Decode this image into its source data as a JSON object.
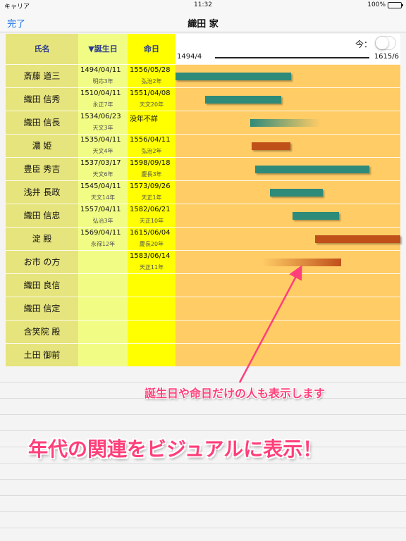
{
  "status": {
    "carrier": "キャリア",
    "time": "11:32",
    "battery": "100%"
  },
  "nav": {
    "done": "完了",
    "title": "織田 家"
  },
  "columns": {
    "name": "氏名",
    "birth": "▼誕生日",
    "death": "命日"
  },
  "timeline": {
    "now_label": "今：",
    "now_toggle_on": false,
    "start": "1494/4",
    "end": "1615/6",
    "start_year": 1494.25,
    "end_year": 1615.45
  },
  "colors": {
    "male": "#2e8b7a",
    "female": "#c0501a",
    "accent": "#ff3f7a"
  },
  "rows": [
    {
      "name": "斎藤 道三",
      "birth": "1494/04/11",
      "birth_era": "明応3年",
      "death": "1556/05/28",
      "death_era": "弘治2年",
      "bar_start": 1494.3,
      "bar_end": 1556.4,
      "color": "male",
      "fade": ""
    },
    {
      "name": "織田 信秀",
      "birth": "1510/04/11",
      "birth_era": "永正7年",
      "death": "1551/04/08",
      "death_era": "天文20年",
      "bar_start": 1510.3,
      "bar_end": 1551.3,
      "color": "male",
      "fade": ""
    },
    {
      "name": "織田 信長",
      "birth": "1534/06/23",
      "birth_era": "天文3年",
      "death": "没年不詳",
      "death_era": "",
      "bar_start": 1534.5,
      "bar_end": 1572.0,
      "color": "male",
      "fade": "fade-start"
    },
    {
      "name": "濃 姫",
      "birth": "1535/04/11",
      "birth_era": "天文4年",
      "death": "1556/04/11",
      "death_era": "弘治2年",
      "bar_start": 1535.3,
      "bar_end": 1556.3,
      "color": "female",
      "fade": ""
    },
    {
      "name": "豊臣 秀吉",
      "birth": "1537/03/17",
      "birth_era": "天文6年",
      "death": "1598/09/18",
      "death_era": "慶長3年",
      "bar_start": 1537.2,
      "bar_end": 1598.7,
      "color": "male",
      "fade": ""
    },
    {
      "name": "浅井 長政",
      "birth": "1545/04/11",
      "birth_era": "天文14年",
      "death": "1573/09/26",
      "death_era": "天正1年",
      "bar_start": 1545.3,
      "bar_end": 1573.7,
      "color": "male",
      "fade": ""
    },
    {
      "name": "織田 信忠",
      "birth": "1557/04/11",
      "birth_era": "弘治3年",
      "death": "1582/06/21",
      "death_era": "天正10年",
      "bar_start": 1557.3,
      "bar_end": 1582.5,
      "color": "male",
      "fade": ""
    },
    {
      "name": "淀 殿",
      "birth": "1569/04/11",
      "birth_era": "永禄12年",
      "death": "1615/06/04",
      "death_era": "慶長20年",
      "bar_start": 1569.3,
      "bar_end": 1615.45,
      "color": "female",
      "fade": ""
    },
    {
      "name": "お市 の方",
      "birth": "",
      "birth_era": "",
      "death": "1583/06/14",
      "death_era": "天正11年",
      "bar_start": 1541.0,
      "bar_end": 1583.4,
      "color": "female",
      "fade": "fade-end"
    },
    {
      "name": "織田 良信",
      "birth": "",
      "birth_era": "",
      "death": "",
      "death_era": ""
    },
    {
      "name": "織田 信定",
      "birth": "",
      "birth_era": "",
      "death": "",
      "death_era": ""
    },
    {
      "name": "含笑院 殿",
      "birth": "",
      "birth_era": "",
      "death": "",
      "death_era": ""
    },
    {
      "name": "土田 御前",
      "birth": "",
      "birth_era": "",
      "death": "",
      "death_era": ""
    }
  ],
  "callouts": {
    "small": "誕生日や命日だけの人も表示します",
    "big": "年代の関連をビジュアルに表示！"
  }
}
